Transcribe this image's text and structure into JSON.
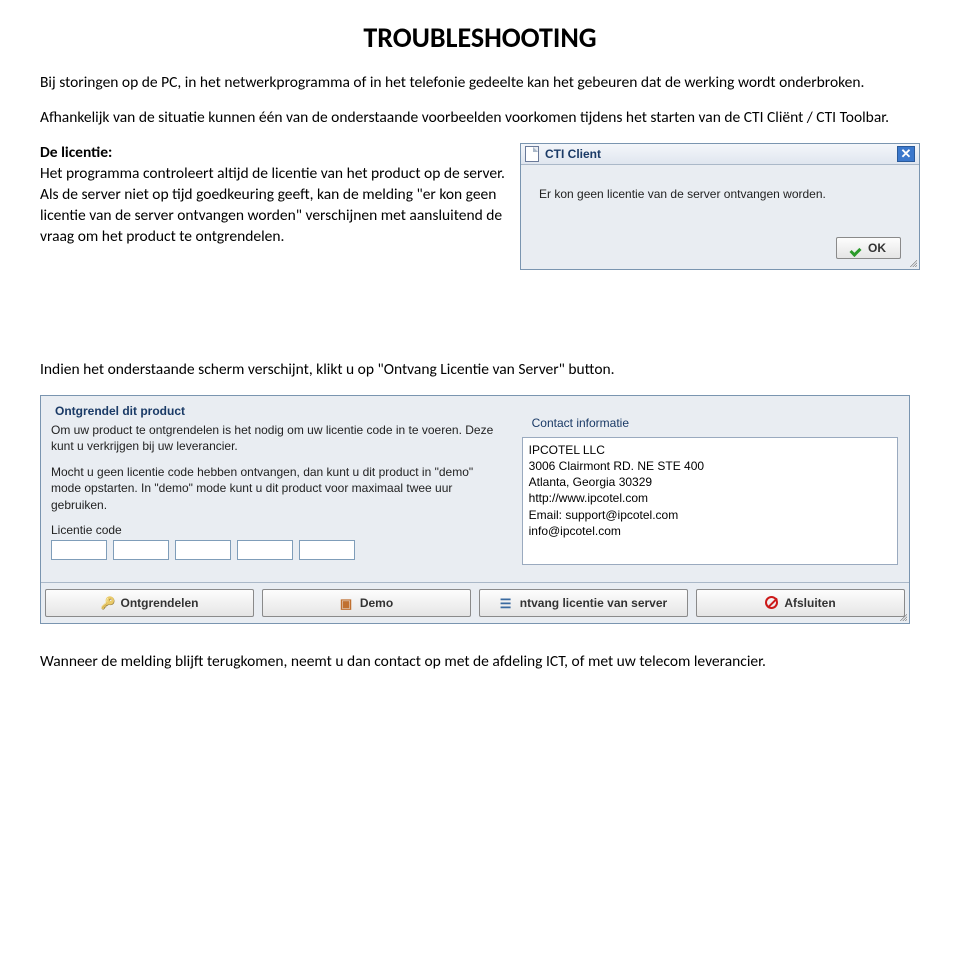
{
  "doc": {
    "title": "TROUBLESHOOTING",
    "p1": "Bij storingen op de PC, in het netwerkprogramma of in het telefonie gedeelte kan het gebeuren dat de werking wordt onderbroken.",
    "p2": "Afhankelijk van de situatie kunnen één van de onderstaande voorbeelden voorkomen tijdens het starten van de CTI Cliënt / CTI Toolbar.",
    "licentie_label": "De licentie:",
    "licentie_text": "Het programma controleert altijd de licentie van het product op de server. Als de server niet op tijd goedkeuring geeft, kan de melding \"er kon geen licentie van de server ontvangen worden\" verschijnen met aansluitend de vraag om het product te ontgrendelen.",
    "p3": "Indien het onderstaande scherm verschijnt, klikt u op \"Ontvang Licentie van Server\" button.",
    "p4": "Wanneer de melding blijft terugkomen, neemt u dan contact op met de afdeling ICT, of met uw telecom leverancier."
  },
  "dlg1": {
    "title": "CTI Client",
    "message": "Er kon geen licentie van de server ontvangen worden.",
    "ok": "OK"
  },
  "dlg2": {
    "fieldset_title": "Ontgrendel dit product",
    "intro1": "Om uw product te ontgrendelen is het nodig om uw licentie code in te voeren. Deze kunt u verkrijgen bij uw leverancier.",
    "intro2": "Mocht u geen licentie code hebben ontvangen, dan kunt u dit product in \"demo\" mode opstarten. In \"demo\" mode kunt u dit product voor maximaal twee uur gebruiken.",
    "lic_label": "Licentie code",
    "contact_legend": "Contact informatie",
    "contact_lines": [
      "IPCOTEL LLC",
      "3006 Clairmont RD. NE STE 400",
      "Atlanta, Georgia 30329",
      "",
      "http://www.ipcotel.com",
      "Email: support@ipcotel.com",
      "           info@ipcotel.com"
    ],
    "buttons": {
      "ontgrendelen": "Ontgrendelen",
      "demo": "Demo",
      "ontvang": "ntvang licentie van server",
      "afsluiten": "Afsluiten"
    }
  }
}
